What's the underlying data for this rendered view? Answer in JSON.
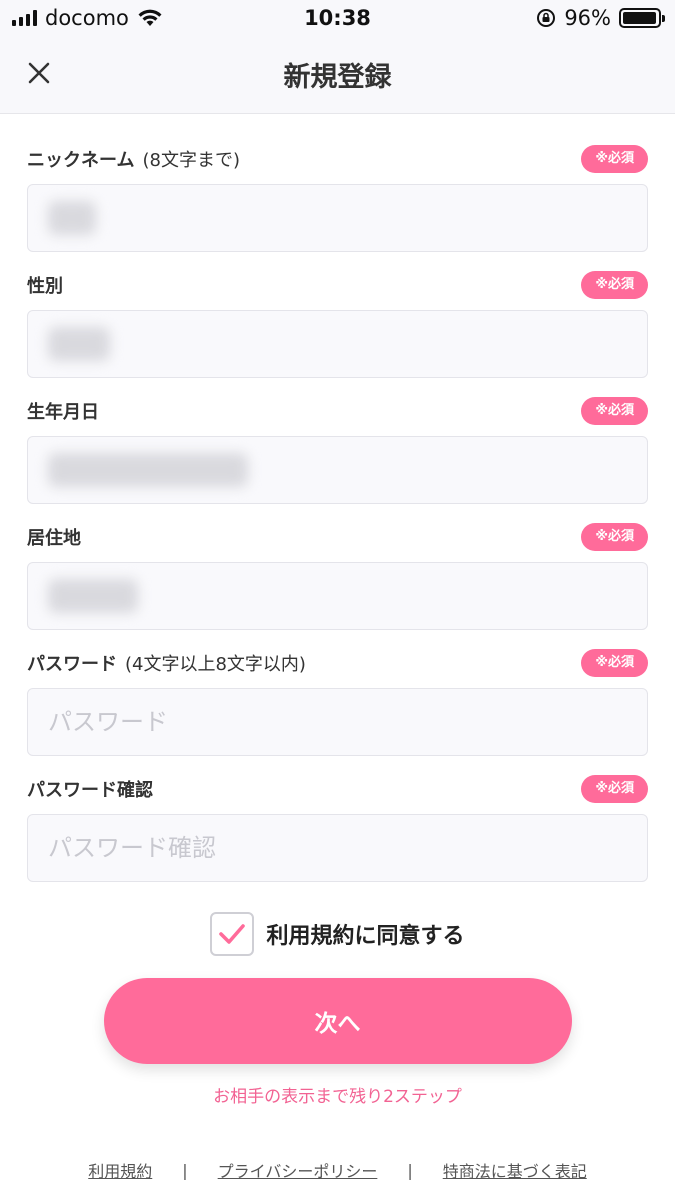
{
  "status_bar": {
    "carrier": "docomo",
    "time": "10:38",
    "battery_percent": "96%",
    "battery_level": 0.96
  },
  "header": {
    "title": "新規登録",
    "close_icon": "close-icon"
  },
  "required_label": "※必須",
  "fields": {
    "nickname": {
      "label": "ニックネーム",
      "note": "(8文字まで)"
    },
    "gender": {
      "label": "性別"
    },
    "birthday": {
      "label": "生年月日"
    },
    "residence": {
      "label": "居住地"
    },
    "password": {
      "label": "パスワード",
      "note": "(4文字以上8文字以内)",
      "placeholder": "パスワード"
    },
    "password_confirm": {
      "label": "パスワード確認",
      "placeholder": "パスワード確認"
    }
  },
  "agreement": {
    "checked": true,
    "label": "利用規約に同意する"
  },
  "next_button": "次へ",
  "steps_remaining": "お相手の表示まで残り2ステップ",
  "footer": {
    "terms": "利用規約",
    "privacy": "プライバシーポリシー",
    "commerce": "特商法に基づく表記",
    "separator": "|"
  },
  "colors": {
    "accent": "#ff6b9a",
    "steps_text": "#f26393",
    "input_bg": "#f9f9fc"
  }
}
